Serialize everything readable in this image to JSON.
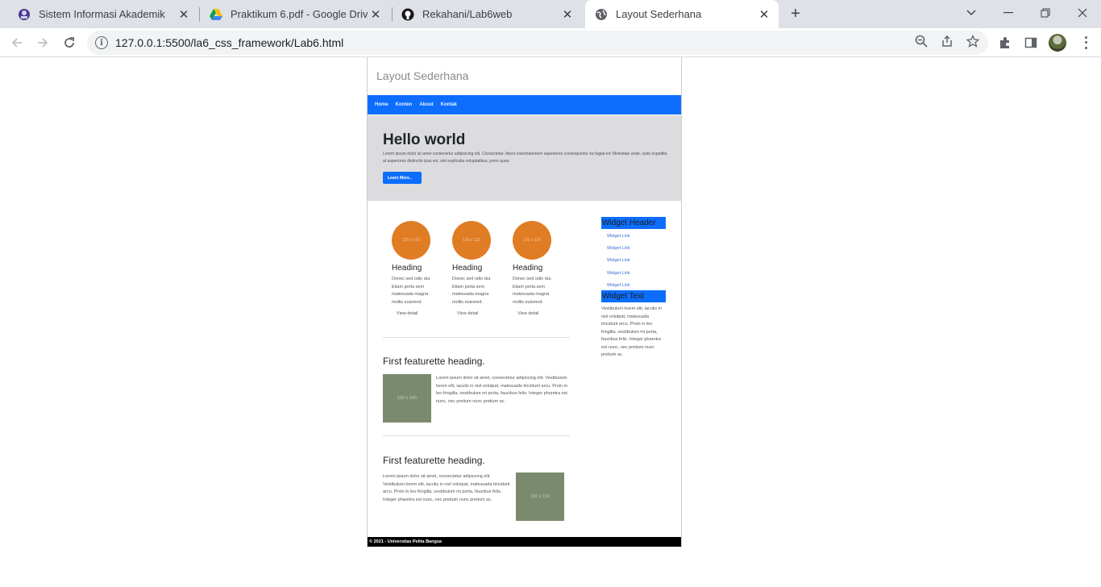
{
  "browser": {
    "tabs": [
      {
        "title": "Sistem Informasi Akademik",
        "icon": "campus-logo-icon"
      },
      {
        "title": "Praktikum 6.pdf - Google Drive",
        "icon": "google-drive-icon"
      },
      {
        "title": "Rekahani/Lab6web",
        "icon": "github-icon"
      },
      {
        "title": "Layout Sederhana",
        "icon": "globe-icon"
      }
    ],
    "url": "127.0.0.1:5500/la6_css_framework/Lab6.html"
  },
  "page": {
    "site_title": "Layout Sederhana",
    "nav": [
      "Home",
      "Konten",
      "About",
      "Kontak"
    ],
    "hero": {
      "heading": "Hello world",
      "text": "Lorem ipsum dolor sit amet consectetur adipisicing elit. Consectetur, libero exercitationem asperiores consequuntur ea fugiat ex! Molestiae unde, iusto expedita at asperiores distinctio ipsa est, sint explicabo voluptatibus, porro quae.",
      "button": "Learn More.."
    },
    "cards": [
      {
        "img": "120 x 120",
        "heading": "Heading",
        "text": "Donec sed odio dui. Etiam porta sem malesuada magna mollis euismod.",
        "link": "View detail"
      },
      {
        "img": "120 x 120",
        "heading": "Heading",
        "text": "Donec sed odio dui. Etiam porta sem malesuada magna mollis euismod.",
        "link": "View detail"
      },
      {
        "img": "120 x 120",
        "heading": "Heading",
        "text": "Donec sed odio dui. Etiam porta sem malesuada magna mollis euismod.",
        "link": "View detail"
      }
    ],
    "featurettes": [
      {
        "heading": "First featurette heading.",
        "img": "150 x 150",
        "text": "Lorem ipsum dolor sit amet, consectetur adipiscing elit. Vestibulum lorem elit, iaculis in nisl volutpat, malesuada tincidunt arcu. Proin in leo fringilla, vestibulum mi porta, faucibus felis. Integer pharetra est nunc, nec pretium nunc pretium ac."
      },
      {
        "heading": "First featurette heading.",
        "img": "150 x 150",
        "text": "Lorem ipsum dolor sit amet, consectetur adipiscing elit. Vestibulum lorem elit, iaculis in nisl volutpat, malesuada tincidunt arcu. Proin in leo fringilla, vestibulum mi porta, faucibus felis. Integer pharetra est nunc, nec pretium nunc pretium ac."
      }
    ],
    "sidebar": {
      "widget_header": "Widget Header",
      "links": [
        "Widget Link",
        "Widget Link",
        "Widget Link",
        "Widget Link",
        "Widget Link"
      ],
      "widget_text_header": "Widget Text",
      "widget_text": "Vestibulum lorem elit, iaculis in nisl volutpat, malesuada tincidunt arcu. Proin in leo fringilla, vestibulum mi porta, faucibus felis. Integer pharetra est nunc, nec pretium nunc pretium ac."
    },
    "footer": "© 2021 - Universitas Pelita Bangsa"
  },
  "colors": {
    "primary": "#0d6efd",
    "hero_bg": "#dcdcdf",
    "circle": "#e07c24",
    "feature_img": "#7b8a6e",
    "footer": "#000000"
  }
}
